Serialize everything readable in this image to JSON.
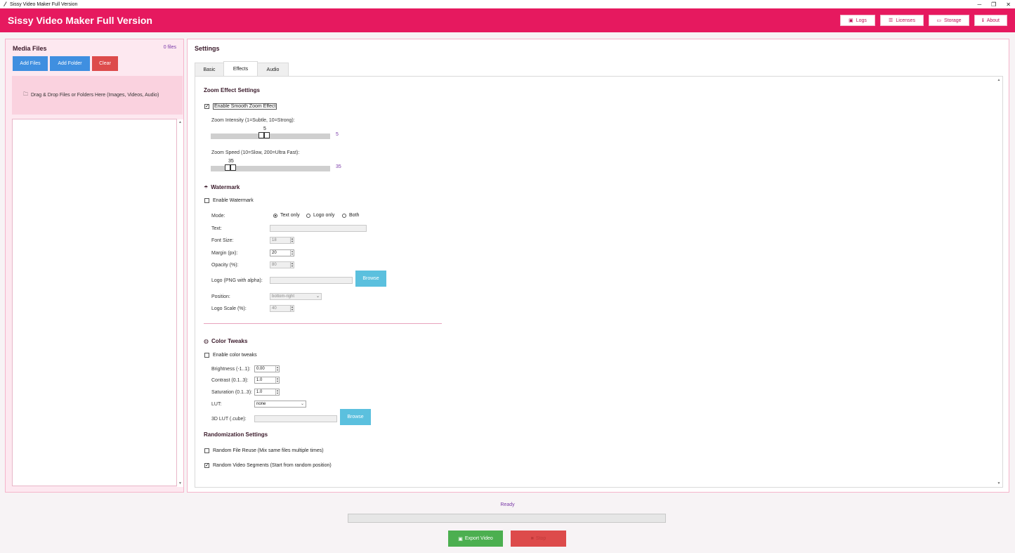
{
  "window": {
    "title": "Sissy Video Maker Full Version",
    "controls": [
      "─",
      "❐",
      "✕"
    ]
  },
  "header": {
    "app_name": "Sissy Video Maker Full Version",
    "nav": [
      {
        "label": "Logs",
        "icon": "log-icon"
      },
      {
        "label": "Licenses",
        "icon": "list-icon"
      },
      {
        "label": "Storage",
        "icon": "folder-icon"
      },
      {
        "label": "About",
        "icon": "info-icon"
      }
    ],
    "colors": {
      "brand": "#e6195f"
    }
  },
  "media": {
    "title": "Media Files",
    "count": "0 files",
    "add_files": "Add Files",
    "add_folder": "Add Folder",
    "clear": "Clear",
    "dropzone": "Drag & Drop Files or Folders Here (Images, Videos, Audio)"
  },
  "settings": {
    "title": "Settings",
    "tabs": [
      {
        "label": "Basic",
        "active": false
      },
      {
        "label": "Effects",
        "active": true
      },
      {
        "label": "Audio",
        "active": false
      }
    ],
    "zoom": {
      "title": "Zoom Effect Settings",
      "enable_label": "Enable Smooth Zoom Effect",
      "enable_checked": true,
      "intensity_label": "Zoom Intensity (1=Subtle, 10=Strong):",
      "intensity_value": "5",
      "intensity_min": 1,
      "intensity_max": 10,
      "speed_label": "Zoom Speed (10=Slow, 200=Ultra Fast):",
      "speed_value": "35",
      "speed_min": 10,
      "speed_max": 200
    },
    "watermark": {
      "title": "Watermark",
      "enable_label": "Enable Watermark",
      "enable_checked": false,
      "mode_label": "Mode:",
      "modes": [
        {
          "label": "Text only",
          "selected": true
        },
        {
          "label": "Logo only",
          "selected": false
        },
        {
          "label": "Both",
          "selected": false
        }
      ],
      "text_label": "Text:",
      "text_value": "",
      "font_size_label": "Font Size:",
      "font_size_value": "18",
      "margin_label": "Margin (px):",
      "margin_value": "20",
      "opacity_label": "Opacity (%):",
      "opacity_value": "80",
      "logo_label": "Logo (PNG with alpha):",
      "logo_value": "",
      "browse": "Browse",
      "position_label": "Position:",
      "position_value": "bottom-right",
      "logo_scale_label": "Logo Scale (%):",
      "logo_scale_value": "40"
    },
    "color": {
      "title": "Color Tweaks",
      "enable_label": "Enable color tweaks",
      "enable_checked": false,
      "brightness_label": "Brightness (-1..1):",
      "brightness_value": "0.00",
      "contrast_label": "Contrast (0.1..3):",
      "contrast_value": "1.0",
      "saturation_label": "Saturation (0.1..3):",
      "saturation_value": "1.0",
      "lut_label": "LUT:",
      "lut_value": "none",
      "lut3d_label": "3D LUT (.cube):",
      "lut3d_value": "",
      "browse": "Browse"
    },
    "random": {
      "title": "Randomization Settings",
      "reuse_label": "Random File Reuse (Mix same files multiple times)",
      "reuse_checked": false,
      "segments_label": "Random Video Segments (Start from random position)",
      "segments_checked": true
    }
  },
  "footer": {
    "status": "Ready",
    "progress": 0,
    "export": "Export Video",
    "stop": "Stop"
  }
}
